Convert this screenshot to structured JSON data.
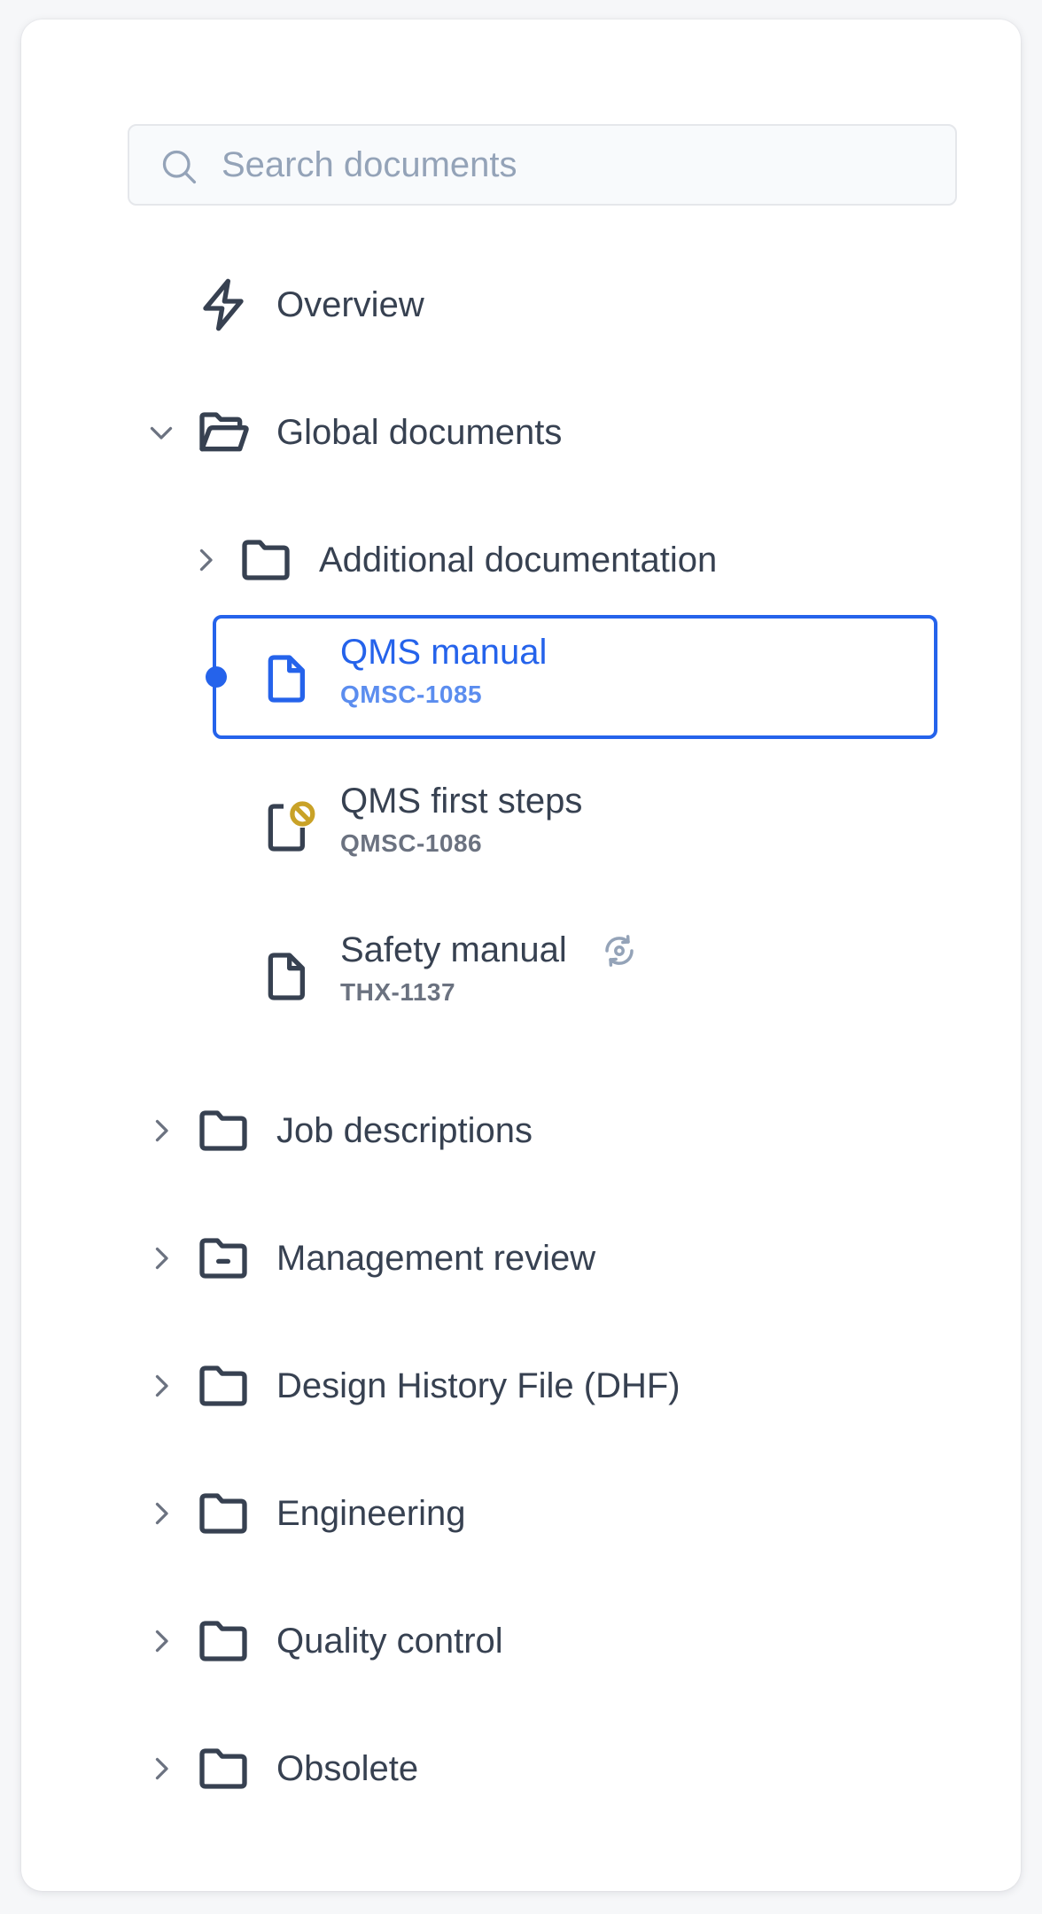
{
  "search": {
    "placeholder": "Search documents",
    "value": ""
  },
  "tree": {
    "overview": {
      "label": "Overview",
      "icon": "lightning-icon"
    },
    "global_documents": {
      "label": "Global documents",
      "icon": "folder-open-icon",
      "expanded": true
    },
    "additional_documentation": {
      "label": "Additional documentation",
      "icon": "folder-icon",
      "expanded": false
    },
    "documents": [
      {
        "title": "QMS manual",
        "code": "QMSC-1085",
        "icon": "document-icon",
        "selected": true
      },
      {
        "title": "QMS first steps",
        "code": "QMSC-1086",
        "icon": "document-blocked-icon",
        "selected": false
      },
      {
        "title": "Safety manual",
        "code": "THX-1137",
        "icon": "document-icon",
        "badge_icon": "sync-icon",
        "selected": false
      }
    ],
    "folders": [
      {
        "label": "Job descriptions",
        "icon": "folder-icon"
      },
      {
        "label": "Management review",
        "icon": "folder-minus-icon"
      },
      {
        "label": "Design History File (DHF)",
        "icon": "folder-icon"
      },
      {
        "label": "Engineering",
        "icon": "folder-icon"
      },
      {
        "label": "Quality control",
        "icon": "folder-icon"
      },
      {
        "label": "Obsolete",
        "icon": "folder-icon"
      }
    ]
  },
  "colors": {
    "accent": "#2563eb",
    "accent_light": "#5b8def",
    "text": "#374151",
    "muted": "#6b7280",
    "warning": "#c9a227",
    "icon": "#374151",
    "chevron": "#6b7280"
  }
}
